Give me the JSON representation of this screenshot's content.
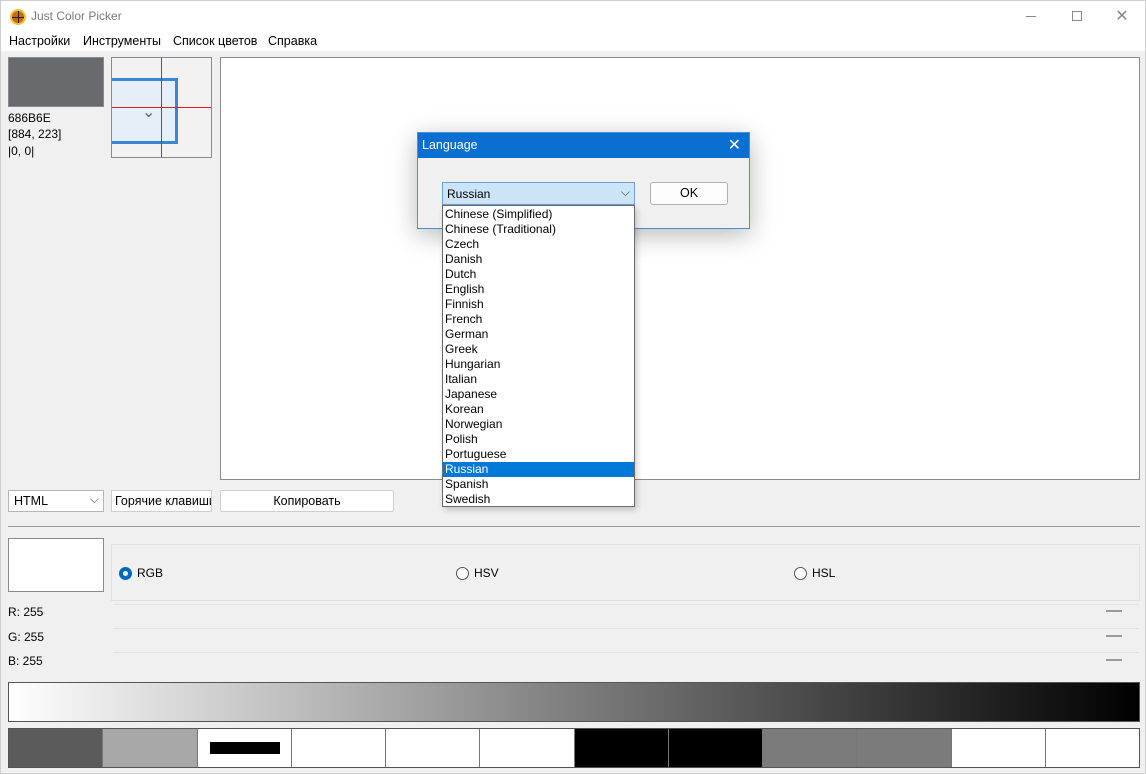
{
  "window": {
    "title": "Just Color Picker",
    "close_glyph": "✕"
  },
  "menu": [
    "Настройки",
    "Инструменты",
    "Список цветов",
    "Справка"
  ],
  "current_color": {
    "hex": "686B6E",
    "coords": "[884, 223]",
    "relative": "|0, 0|",
    "swatch_color": "#686b6e"
  },
  "controls": {
    "format": "HTML",
    "format_chevron": "⌵",
    "hotkeys": "Горячие клавиши",
    "copy": "Копировать"
  },
  "color_models": {
    "options": [
      "RGB",
      "HSV",
      "HSL"
    ],
    "selected": "RGB"
  },
  "components": [
    {
      "label": "R: 255"
    },
    {
      "label": "G: 255"
    },
    {
      "label": "B: 255"
    }
  ],
  "palette": [
    "#5b5b5b",
    "#a8a8a8",
    "#ffffff",
    "#ffffff",
    "#ffffff",
    "#ffffff",
    "#000000",
    "#000000",
    "#7b7b7b",
    "#7b7b7b",
    "#ffffff",
    "#ffffff"
  ],
  "dialog": {
    "title": "Language",
    "close_glyph": "✕",
    "selected_language": "Russian",
    "chevron": "⌵",
    "ok_label": "OK",
    "languages": [
      "Chinese (Simplified)",
      "Chinese (Traditional)",
      "Czech",
      "Danish",
      "Dutch",
      "English",
      "Finnish",
      "French",
      "German",
      "Greek",
      "Hungarian",
      "Italian",
      "Japanese",
      "Korean",
      "Norwegian",
      "Polish",
      "Portuguese",
      "Russian",
      "Spanish",
      "Swedish"
    ]
  },
  "colors": {
    "accent": "#0067c0",
    "dialog_title_bg": "#0b6fd1",
    "selection": "#0078d7"
  }
}
